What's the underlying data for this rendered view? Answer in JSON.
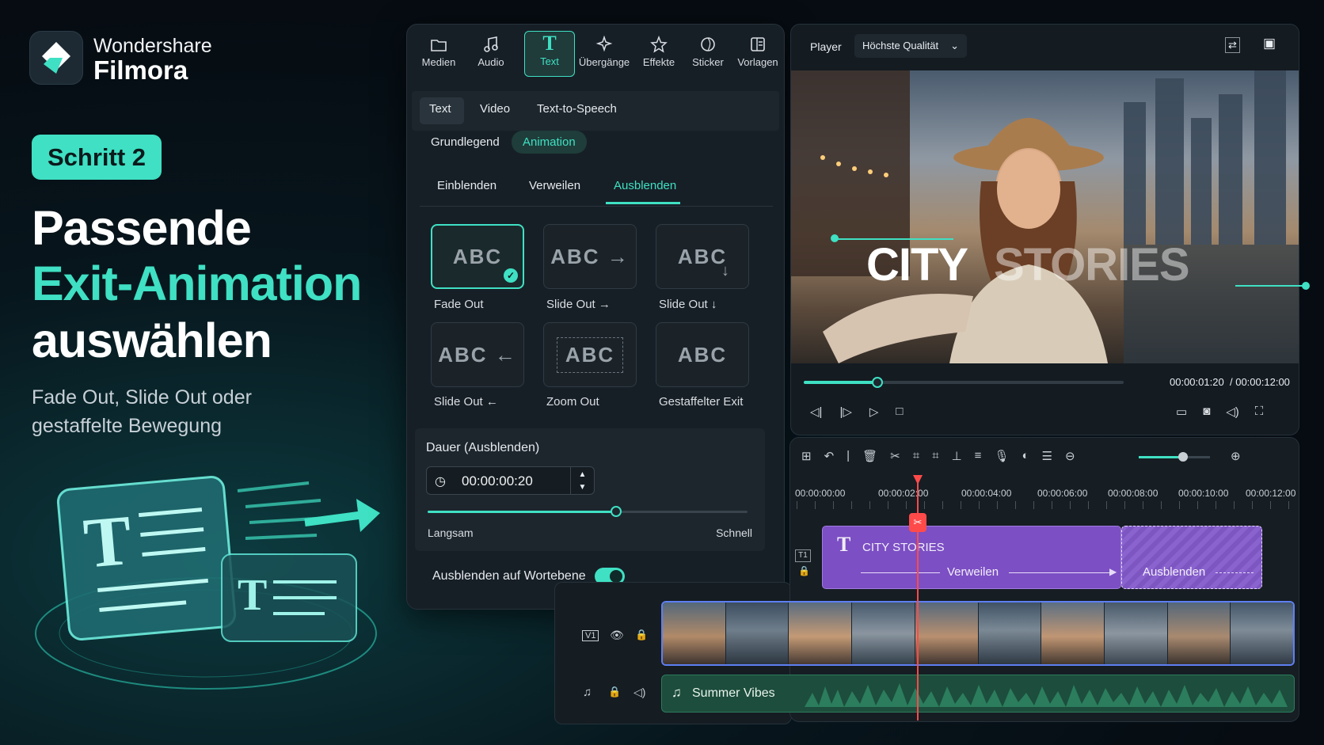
{
  "brand": {
    "line1": "Wondershare",
    "line2": "Filmora"
  },
  "hero": {
    "step": "Schritt 2",
    "title1": "Passende",
    "title2": "Exit-Animation",
    "title3": "auswählen",
    "subtitle": "Fade Out, Slide Out oder gestaffelte Bewegung"
  },
  "toolbar": {
    "items": [
      {
        "label": "Medien",
        "icon": "folder-icon"
      },
      {
        "label": "Audio",
        "icon": "music-icon"
      },
      {
        "label": "Text",
        "icon": "text-icon"
      },
      {
        "label": "Übergänge",
        "icon": "transition-icon"
      },
      {
        "label": "Effekte",
        "icon": "sparkle-icon"
      },
      {
        "label": "Sticker",
        "icon": "sticker-icon"
      },
      {
        "label": "Vorlagen",
        "icon": "template-icon"
      }
    ],
    "active": "Text"
  },
  "panel": {
    "tabs": [
      "Text",
      "Video",
      "Text-to-Speech"
    ],
    "subtabs": [
      "Grundlegend",
      "Animation"
    ],
    "animtabs": [
      "Einblenden",
      "Verweilen",
      "Ausblenden"
    ],
    "cards": [
      {
        "label": "Fade Out",
        "preview": "ABC"
      },
      {
        "label": "Slide Out →",
        "preview": "ABC →"
      },
      {
        "label": "Slide Out ↓",
        "preview": "ABC"
      },
      {
        "label": "Slide Out ←",
        "preview": "ABC ←"
      },
      {
        "label": "Zoom Out",
        "preview": "ABC"
      },
      {
        "label": "Gestaffelter Exit",
        "preview": "ABC"
      }
    ],
    "duration": {
      "label": "Dauer (Ausblenden)",
      "value": "00:00:00:20",
      "slow": "Langsam",
      "fast": "Schnell",
      "level": 0.59
    },
    "toggle": {
      "label": "Ausblenden auf Wortebene",
      "on": true
    }
  },
  "player": {
    "label": "Player",
    "quality": "Höchste Qualität",
    "overlay1": "CITY",
    "overlay2": "STORIES",
    "current": "00:00:01:20",
    "total": "/ 00:00:12:00",
    "progress": 0.23
  },
  "timeline": {
    "ruler": [
      "00:00:00:00",
      "00:00:02:00",
      "00:00:04:00",
      "00:00:06:00",
      "00:00:08:00",
      "00:00:10:00",
      "00:00:12:00"
    ],
    "textclip": {
      "title": "CITY STORIES",
      "mid": "Verweilen",
      "end": "Ausblenden"
    },
    "videotrack": "V1",
    "audioclip": "Summer Vibes"
  },
  "colors": {
    "accent": "#3fe0c3",
    "clip": "#7c4fc4",
    "playhead": "#ff4a4a"
  }
}
